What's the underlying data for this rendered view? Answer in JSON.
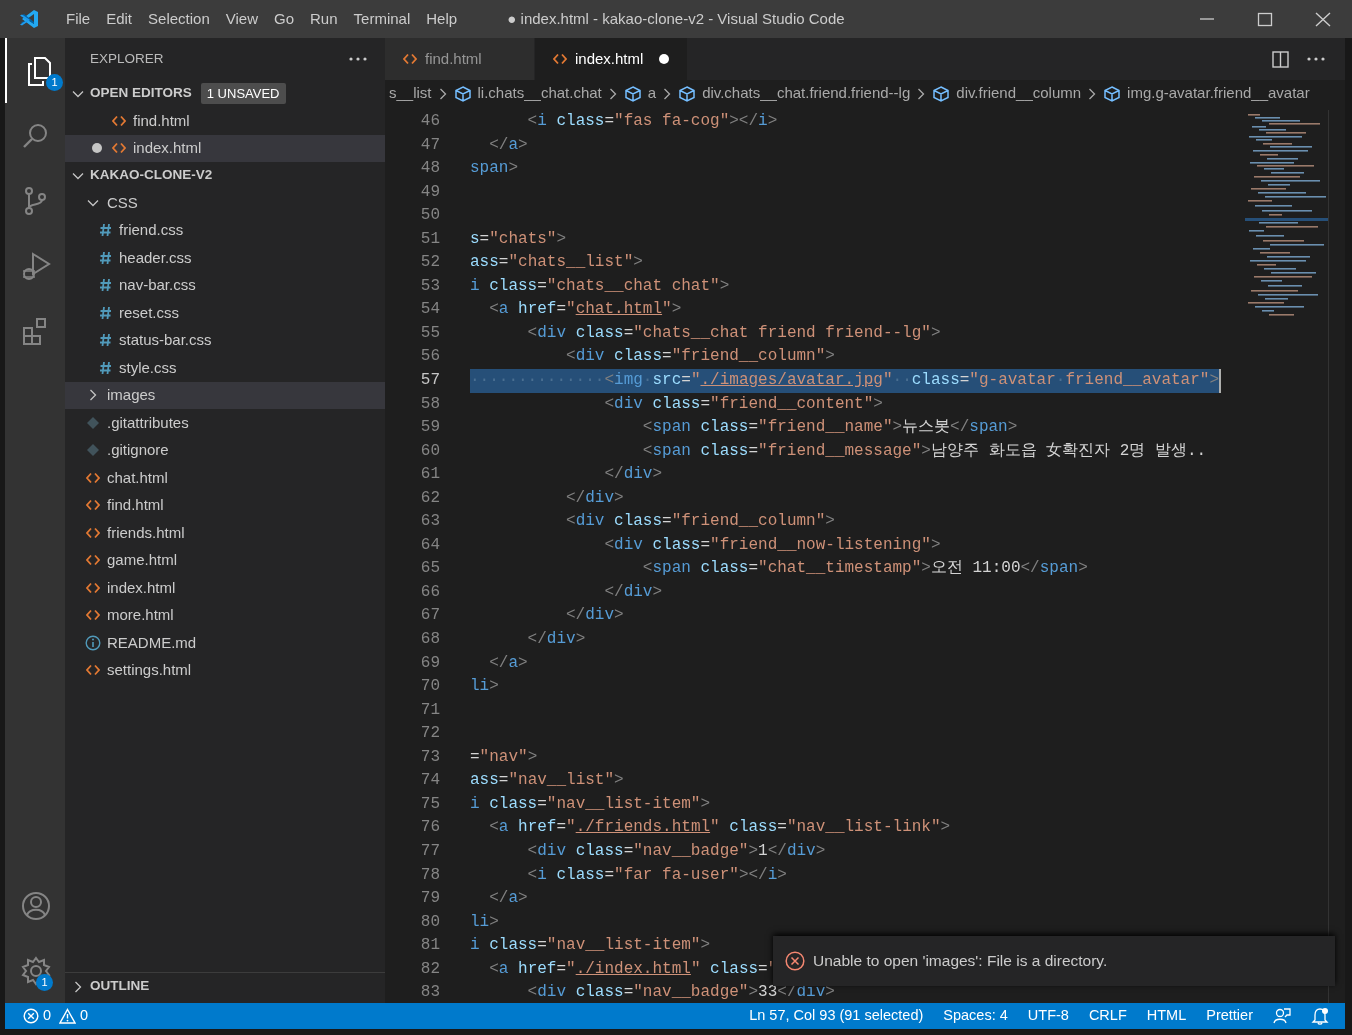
{
  "title_bar": {
    "menu": [
      "File",
      "Edit",
      "Selection",
      "View",
      "Go",
      "Run",
      "Terminal",
      "Help"
    ],
    "title": "● index.html - kakao-clone-v2 - Visual Studio Code"
  },
  "activity_bar": {
    "items": [
      {
        "kind": "files",
        "selected": true,
        "badge": "1"
      },
      {
        "kind": "search",
        "selected": false
      },
      {
        "kind": "source-control",
        "selected": false
      },
      {
        "kind": "run",
        "selected": false
      },
      {
        "kind": "extensions",
        "selected": false
      }
    ],
    "bottom": [
      {
        "kind": "account"
      },
      {
        "kind": "settings",
        "badge": "1"
      }
    ]
  },
  "sidebar": {
    "title": "EXPLORER",
    "sections": [
      {
        "label": "OPEN EDITORS",
        "expanded": true,
        "badge": "1 UNSAVED",
        "items": [
          {
            "label": "find.html",
            "kind": "html",
            "unsaved": false,
            "selected": false
          },
          {
            "label": "index.html",
            "kind": "html",
            "unsaved": true,
            "selected": true
          }
        ]
      },
      {
        "label": "KAKAO-CLONE-V2",
        "expanded": true,
        "items": [
          {
            "label": "CSS",
            "kind": "folder",
            "expanded": true,
            "selected": false,
            "children": [
              {
                "label": "friend.css",
                "kind": "css",
                "selected": false
              },
              {
                "label": "header.css",
                "kind": "css",
                "selected": false
              },
              {
                "label": "nav-bar.css",
                "kind": "css",
                "selected": false
              },
              {
                "label": "reset.css",
                "kind": "css",
                "selected": false
              },
              {
                "label": "status-bar.css",
                "kind": "css",
                "selected": false
              },
              {
                "label": "style.css",
                "kind": "css",
                "selected": false
              }
            ]
          },
          {
            "label": "images",
            "kind": "folder",
            "expanded": false,
            "selected": true
          },
          {
            "label": ".gitattributes",
            "kind": "git",
            "selected": false
          },
          {
            "label": ".gitignore",
            "kind": "git",
            "selected": false
          },
          {
            "label": "chat.html",
            "kind": "html",
            "selected": false
          },
          {
            "label": "find.html",
            "kind": "html",
            "selected": false
          },
          {
            "label": "friends.html",
            "kind": "html",
            "selected": false
          },
          {
            "label": "game.html",
            "kind": "html",
            "selected": false
          },
          {
            "label": "index.html",
            "kind": "html",
            "selected": false
          },
          {
            "label": "more.html",
            "kind": "html",
            "selected": false
          },
          {
            "label": "README.md",
            "kind": "info",
            "selected": false
          },
          {
            "label": "settings.html",
            "kind": "html",
            "selected": false
          }
        ]
      },
      {
        "label": "OUTLINE",
        "expanded": false
      }
    ]
  },
  "tabs": [
    {
      "label": "find.html",
      "selected": false,
      "unsaved": false
    },
    {
      "label": "index.html",
      "selected": true,
      "unsaved": true
    }
  ],
  "breadcrumbs": [
    {
      "label": "s__list",
      "kind": "plain"
    },
    {
      "label": "li.chats__chat.chat",
      "kind": "element"
    },
    {
      "label": "a",
      "kind": "element"
    },
    {
      "label": "div.chats__chat.friend.friend--lg",
      "kind": "element"
    },
    {
      "label": "div.friend__column",
      "kind": "element"
    },
    {
      "label": "img.g-avatar.friend__avatar",
      "kind": "element"
    }
  ],
  "editor": {
    "lines": [
      {
        "number": "46",
        "selected": false,
        "tokens": [
          {
            "kind": "punct",
            "t": "      <"
          },
          {
            "kind": "tag",
            "t": "i"
          },
          {
            "kind": "attr",
            "t": " class"
          },
          {
            "kind": "eq",
            "t": "="
          },
          {
            "kind": "str",
            "t": "\"fas fa-cog\""
          },
          {
            "kind": "punct",
            "t": "></"
          },
          {
            "kind": "tag",
            "t": "i"
          },
          {
            "kind": "punct",
            "t": ">"
          }
        ]
      },
      {
        "number": "47",
        "selected": false,
        "tokens": [
          {
            "kind": "punct",
            "t": "  </"
          },
          {
            "kind": "tag",
            "t": "a"
          },
          {
            "kind": "punct",
            "t": ">"
          }
        ]
      },
      {
        "number": "48",
        "selected": false,
        "tokens": [
          {
            "kind": "tag",
            "t": "span"
          },
          {
            "kind": "punct",
            "t": ">"
          }
        ]
      },
      {
        "number": "49",
        "selected": false
      },
      {
        "number": "50",
        "selected": false
      },
      {
        "number": "51",
        "selected": false,
        "tokens": [
          {
            "kind": "attr",
            "t": "s"
          },
          {
            "kind": "eq",
            "t": "="
          },
          {
            "kind": "str",
            "t": "\"chats\""
          },
          {
            "kind": "punct",
            "t": ">"
          }
        ]
      },
      {
        "number": "52",
        "selected": false,
        "tokens": [
          {
            "kind": "attr",
            "t": "ass"
          },
          {
            "kind": "eq",
            "t": "="
          },
          {
            "kind": "str",
            "t": "\"chats__list\""
          },
          {
            "kind": "punct",
            "t": ">"
          }
        ]
      },
      {
        "number": "53",
        "selected": false,
        "tokens": [
          {
            "kind": "tag",
            "t": "i"
          },
          {
            "kind": "attr",
            "t": " class"
          },
          {
            "kind": "eq",
            "t": "="
          },
          {
            "kind": "str",
            "t": "\"chats__chat chat\""
          },
          {
            "kind": "punct",
            "t": ">"
          }
        ]
      },
      {
        "number": "54",
        "selected": false,
        "tokens": [
          {
            "kind": "punct",
            "t": "  <"
          },
          {
            "kind": "tag",
            "t": "a"
          },
          {
            "kind": "attr",
            "t": " href"
          },
          {
            "kind": "eq",
            "t": "="
          },
          {
            "kind": "str",
            "t": "\""
          },
          {
            "kind": "link",
            "t": "chat.html"
          },
          {
            "kind": "str",
            "t": "\""
          },
          {
            "kind": "punct",
            "t": ">"
          }
        ]
      },
      {
        "number": "55",
        "selected": false,
        "tokens": [
          {
            "kind": "punct",
            "t": "      <"
          },
          {
            "kind": "tag",
            "t": "div"
          },
          {
            "kind": "attr",
            "t": " class"
          },
          {
            "kind": "eq",
            "t": "="
          },
          {
            "kind": "str",
            "t": "\"chats__chat friend friend--lg\""
          },
          {
            "kind": "punct",
            "t": ">"
          }
        ]
      },
      {
        "number": "56",
        "selected": false,
        "tokens": [
          {
            "kind": "punct",
            "t": "          <"
          },
          {
            "kind": "tag",
            "t": "div"
          },
          {
            "kind": "attr",
            "t": " class"
          },
          {
            "kind": "eq",
            "t": "="
          },
          {
            "kind": "str",
            "t": "\"friend__column\""
          },
          {
            "kind": "punct",
            "t": ">"
          }
        ]
      },
      {
        "number": "57",
        "selected": true,
        "tokens": [
          {
            "kind": "space",
            "t": "··············"
          },
          {
            "kind": "punct",
            "t": "<"
          },
          {
            "kind": "tag",
            "t": "img"
          },
          {
            "kind": "space",
            "t": "·"
          },
          {
            "kind": "attr",
            "t": "src"
          },
          {
            "kind": "eq",
            "t": "="
          },
          {
            "kind": "str",
            "t": "\""
          },
          {
            "kind": "link",
            "t": "./images/avatar.jpg"
          },
          {
            "kind": "str",
            "t": "\""
          },
          {
            "kind": "space",
            "t": "··"
          },
          {
            "kind": "attr",
            "t": "class"
          },
          {
            "kind": "eq",
            "t": "="
          },
          {
            "kind": "str",
            "t": "\"g-avatar"
          },
          {
            "kind": "space",
            "t": "·"
          },
          {
            "kind": "str",
            "t": "friend__avatar\""
          },
          {
            "kind": "punct",
            "t": ">"
          }
        ]
      },
      {
        "number": "58",
        "selected": false,
        "tokens": [
          {
            "kind": "punct",
            "t": "              <"
          },
          {
            "kind": "tag",
            "t": "div"
          },
          {
            "kind": "attr",
            "t": " class"
          },
          {
            "kind": "eq",
            "t": "="
          },
          {
            "kind": "str",
            "t": "\"friend__content\""
          },
          {
            "kind": "punct",
            "t": ">"
          }
        ]
      },
      {
        "number": "59",
        "selected": false,
        "tokens": [
          {
            "kind": "punct",
            "t": "                  <"
          },
          {
            "kind": "tag",
            "t": "span"
          },
          {
            "kind": "attr",
            "t": " class"
          },
          {
            "kind": "eq",
            "t": "="
          },
          {
            "kind": "str",
            "t": "\"friend__name\""
          },
          {
            "kind": "punct",
            "t": ">"
          },
          {
            "kind": "text",
            "t": "뉴스봇"
          },
          {
            "kind": "punct",
            "t": "</"
          },
          {
            "kind": "tag",
            "t": "span"
          },
          {
            "kind": "punct",
            "t": ">"
          }
        ]
      },
      {
        "number": "60",
        "selected": false,
        "tokens": [
          {
            "kind": "punct",
            "t": "                  <"
          },
          {
            "kind": "tag",
            "t": "span"
          },
          {
            "kind": "attr",
            "t": " class"
          },
          {
            "kind": "eq",
            "t": "="
          },
          {
            "kind": "str",
            "t": "\"friend__message\""
          },
          {
            "kind": "punct",
            "t": ">"
          },
          {
            "kind": "text",
            "t": "남양주 화도읍 女확진자 2명 발생.."
          }
        ]
      },
      {
        "number": "61",
        "selected": false,
        "tokens": [
          {
            "kind": "punct",
            "t": "              </"
          },
          {
            "kind": "tag",
            "t": "div"
          },
          {
            "kind": "punct",
            "t": ">"
          }
        ]
      },
      {
        "number": "62",
        "selected": false,
        "tokens": [
          {
            "kind": "punct",
            "t": "          </"
          },
          {
            "kind": "tag",
            "t": "div"
          },
          {
            "kind": "punct",
            "t": ">"
          }
        ]
      },
      {
        "number": "63",
        "selected": false,
        "tokens": [
          {
            "kind": "punct",
            "t": "          <"
          },
          {
            "kind": "tag",
            "t": "div"
          },
          {
            "kind": "attr",
            "t": " class"
          },
          {
            "kind": "eq",
            "t": "="
          },
          {
            "kind": "str",
            "t": "\"friend__column\""
          },
          {
            "kind": "punct",
            "t": ">"
          }
        ]
      },
      {
        "number": "64",
        "selected": false,
        "tokens": [
          {
            "kind": "punct",
            "t": "              <"
          },
          {
            "kind": "tag",
            "t": "div"
          },
          {
            "kind": "attr",
            "t": " class"
          },
          {
            "kind": "eq",
            "t": "="
          },
          {
            "kind": "str",
            "t": "\"friend__now-listening\""
          },
          {
            "kind": "punct",
            "t": ">"
          }
        ]
      },
      {
        "number": "65",
        "selected": false,
        "tokens": [
          {
            "kind": "punct",
            "t": "                  <"
          },
          {
            "kind": "tag",
            "t": "span"
          },
          {
            "kind": "attr",
            "t": " class"
          },
          {
            "kind": "eq",
            "t": "="
          },
          {
            "kind": "str",
            "t": "\"chat__timestamp\""
          },
          {
            "kind": "punct",
            "t": ">"
          },
          {
            "kind": "text",
            "t": "오전 11:00"
          },
          {
            "kind": "punct",
            "t": "</"
          },
          {
            "kind": "tag",
            "t": "span"
          },
          {
            "kind": "punct",
            "t": ">"
          }
        ]
      },
      {
        "number": "66",
        "selected": false,
        "tokens": [
          {
            "kind": "punct",
            "t": "              </"
          },
          {
            "kind": "tag",
            "t": "div"
          },
          {
            "kind": "punct",
            "t": ">"
          }
        ]
      },
      {
        "number": "67",
        "selected": false,
        "tokens": [
          {
            "kind": "punct",
            "t": "          </"
          },
          {
            "kind": "tag",
            "t": "div"
          },
          {
            "kind": "punct",
            "t": ">"
          }
        ]
      },
      {
        "number": "68",
        "selected": false,
        "tokens": [
          {
            "kind": "punct",
            "t": "      </"
          },
          {
            "kind": "tag",
            "t": "div"
          },
          {
            "kind": "punct",
            "t": ">"
          }
        ]
      },
      {
        "number": "69",
        "selected": false,
        "tokens": [
          {
            "kind": "punct",
            "t": "  </"
          },
          {
            "kind": "tag",
            "t": "a"
          },
          {
            "kind": "punct",
            "t": ">"
          }
        ]
      },
      {
        "number": "70",
        "selected": false,
        "tokens": [
          {
            "kind": "tag",
            "t": "li"
          },
          {
            "kind": "punct",
            "t": ">"
          }
        ]
      },
      {
        "number": "71",
        "selected": false
      },
      {
        "number": "72",
        "selected": false
      },
      {
        "number": "73",
        "selected": false,
        "tokens": [
          {
            "kind": "eq",
            "t": "="
          },
          {
            "kind": "str",
            "t": "\"nav\""
          },
          {
            "kind": "punct",
            "t": ">"
          }
        ]
      },
      {
        "number": "74",
        "selected": false,
        "tokens": [
          {
            "kind": "attr",
            "t": "ass"
          },
          {
            "kind": "eq",
            "t": "="
          },
          {
            "kind": "str",
            "t": "\"nav__list\""
          },
          {
            "kind": "punct",
            "t": ">"
          }
        ]
      },
      {
        "number": "75",
        "selected": false,
        "tokens": [
          {
            "kind": "tag",
            "t": "i"
          },
          {
            "kind": "attr",
            "t": " class"
          },
          {
            "kind": "eq",
            "t": "="
          },
          {
            "kind": "str",
            "t": "\"nav__list-item\""
          },
          {
            "kind": "punct",
            "t": ">"
          }
        ]
      },
      {
        "number": "76",
        "selected": false,
        "tokens": [
          {
            "kind": "punct",
            "t": "  <"
          },
          {
            "kind": "tag",
            "t": "a"
          },
          {
            "kind": "attr",
            "t": " href"
          },
          {
            "kind": "eq",
            "t": "="
          },
          {
            "kind": "str",
            "t": "\""
          },
          {
            "kind": "link",
            "t": "./friends.html"
          },
          {
            "kind": "str",
            "t": "\""
          },
          {
            "kind": "attr",
            "t": " class"
          },
          {
            "kind": "eq",
            "t": "="
          },
          {
            "kind": "str",
            "t": "\"nav__list-link\""
          },
          {
            "kind": "punct",
            "t": ">"
          }
        ]
      },
      {
        "number": "77",
        "selected": false,
        "tokens": [
          {
            "kind": "punct",
            "t": "      <"
          },
          {
            "kind": "tag",
            "t": "div"
          },
          {
            "kind": "attr",
            "t": " class"
          },
          {
            "kind": "eq",
            "t": "="
          },
          {
            "kind": "str",
            "t": "\"nav__badge\""
          },
          {
            "kind": "punct",
            "t": ">"
          },
          {
            "kind": "text",
            "t": "1"
          },
          {
            "kind": "punct",
            "t": "</"
          },
          {
            "kind": "tag",
            "t": "div"
          },
          {
            "kind": "punct",
            "t": ">"
          }
        ]
      },
      {
        "number": "78",
        "selected": false,
        "tokens": [
          {
            "kind": "punct",
            "t": "      <"
          },
          {
            "kind": "tag",
            "t": "i"
          },
          {
            "kind": "attr",
            "t": " class"
          },
          {
            "kind": "eq",
            "t": "="
          },
          {
            "kind": "str",
            "t": "\"far fa-user\""
          },
          {
            "kind": "punct",
            "t": "></"
          },
          {
            "kind": "tag",
            "t": "i"
          },
          {
            "kind": "punct",
            "t": ">"
          }
        ]
      },
      {
        "number": "79",
        "selected": false,
        "tokens": [
          {
            "kind": "punct",
            "t": "  </"
          },
          {
            "kind": "tag",
            "t": "a"
          },
          {
            "kind": "punct",
            "t": ">"
          }
        ]
      },
      {
        "number": "80",
        "selected": false,
        "tokens": [
          {
            "kind": "tag",
            "t": "li"
          },
          {
            "kind": "punct",
            "t": ">"
          }
        ]
      },
      {
        "number": "81",
        "selected": false,
        "tokens": [
          {
            "kind": "tag",
            "t": "i"
          },
          {
            "kind": "attr",
            "t": " class"
          },
          {
            "kind": "eq",
            "t": "="
          },
          {
            "kind": "str",
            "t": "\"nav__list-item\""
          },
          {
            "kind": "punct",
            "t": ">"
          }
        ]
      },
      {
        "number": "82",
        "selected": false,
        "tokens": [
          {
            "kind": "punct",
            "t": "  <"
          },
          {
            "kind": "tag",
            "t": "a"
          },
          {
            "kind": "attr",
            "t": " href"
          },
          {
            "kind": "eq",
            "t": "="
          },
          {
            "kind": "str",
            "t": "\""
          },
          {
            "kind": "link",
            "t": "./index.html"
          },
          {
            "kind": "str",
            "t": "\""
          },
          {
            "kind": "attr",
            "t": " class"
          },
          {
            "kind": "eq",
            "t": "="
          },
          {
            "kind": "str",
            "t": "\""
          }
        ]
      },
      {
        "number": "83",
        "selected": false,
        "tokens": [
          {
            "kind": "punct",
            "t": "      <"
          },
          {
            "kind": "tag",
            "t": "div"
          },
          {
            "kind": "attr",
            "t": " class"
          },
          {
            "kind": "eq",
            "t": "="
          },
          {
            "kind": "str",
            "t": "\"nav__badge\""
          },
          {
            "kind": "punct",
            "t": ">"
          },
          {
            "kind": "text",
            "t": "33"
          },
          {
            "kind": "punct",
            "t": "</"
          },
          {
            "kind": "tag",
            "t": "div"
          },
          {
            "kind": "punct",
            "t": ">"
          }
        ]
      }
    ]
  },
  "notification": {
    "kind": "error",
    "message": "Unable to open 'images': File is a directory."
  },
  "status_bar": {
    "errors": "0",
    "warnings": "0",
    "items": [
      "Ln 57, Col 93 (91 selected)",
      "Spaces: 4",
      "UTF-8",
      "CRLF",
      "HTML",
      "Prettier"
    ]
  }
}
